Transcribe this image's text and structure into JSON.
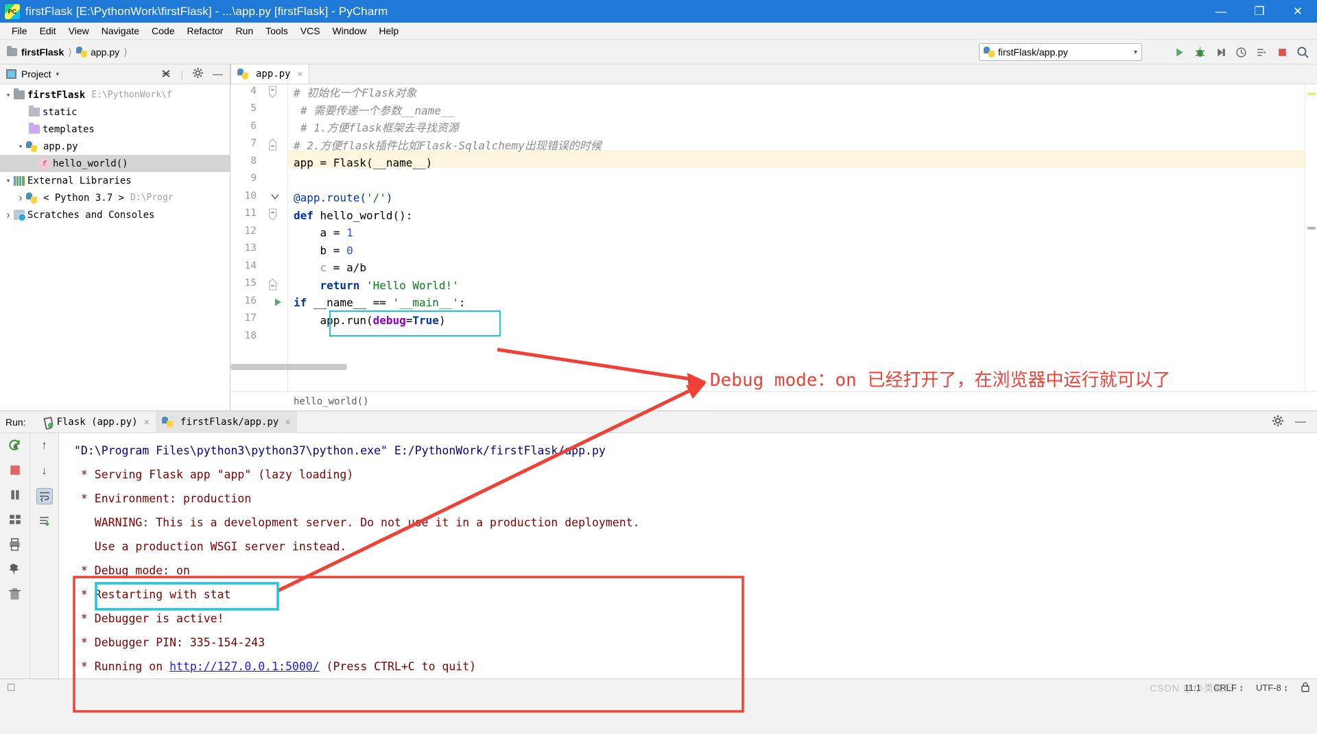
{
  "window": {
    "title": "firstFlask [E:\\PythonWork\\firstFlask] - ...\\app.py [firstFlask] - PyCharm",
    "logo_text": "PC",
    "minimize": "—",
    "maximize": "❐",
    "close": "✕"
  },
  "menubar": [
    "File",
    "Edit",
    "View",
    "Navigate",
    "Code",
    "Refactor",
    "Run",
    "Tools",
    "VCS",
    "Window",
    "Help"
  ],
  "navbar": {
    "breadcrumb": [
      "firstFlask",
      "app.py"
    ],
    "run_config": "firstFlask/app.py",
    "run_config_caret": "▾",
    "icons": [
      "run-icon",
      "debug-icon",
      "coverage-icon",
      "profile-icon",
      "attach-icon",
      "stop-icon",
      "search-icon"
    ]
  },
  "project_panel": {
    "title": "Project",
    "caret": "▾",
    "collapse_all": "collapse-all-icon",
    "settings": "gear-icon",
    "hide": "—",
    "tree": [
      {
        "label": "firstFlask",
        "path": "E:\\PythonWork\\f",
        "depth": 0,
        "arrow": "down",
        "icon": "folder",
        "bold": true,
        "selected": false
      },
      {
        "label": "static",
        "path": "",
        "depth": 1,
        "arrow": "none",
        "icon": "folder-src",
        "bold": false,
        "selected": false
      },
      {
        "label": "templates",
        "path": "",
        "depth": 1,
        "arrow": "none",
        "icon": "folder-tpl",
        "bold": false,
        "selected": false
      },
      {
        "label": "app.py",
        "path": "",
        "depth": 1,
        "arrow": "down",
        "icon": "python",
        "bold": false,
        "selected": false
      },
      {
        "label": "hello_world()",
        "path": "",
        "depth": 2,
        "arrow": "none",
        "icon": "function",
        "bold": false,
        "selected": true
      },
      {
        "label": "External Libraries",
        "path": "",
        "depth": 0,
        "arrow": "down",
        "icon": "library",
        "bold": false,
        "selected": false
      },
      {
        "label": "< Python 3.7 >",
        "path": "D:\\Progr",
        "depth": 1,
        "arrow": "right",
        "icon": "python",
        "bold": false,
        "selected": false
      },
      {
        "label": "Scratches and Consoles",
        "path": "",
        "depth": 0,
        "arrow": "right",
        "icon": "scratches",
        "bold": false,
        "selected": false
      }
    ]
  },
  "editor": {
    "tab": {
      "label": "app.py",
      "close": "✕"
    },
    "breadcrumb": "hello_world()",
    "lines": [
      {
        "num": "4",
        "text": "# 初始化一个Flask对象",
        "type": "comment",
        "fold": "start"
      },
      {
        "num": "5",
        "text": "# 需要传递一个参数__name__",
        "type": "comment",
        "fold": ""
      },
      {
        "num": "6",
        "text": "# 1.方便flask框架去寻找资源",
        "type": "comment",
        "fold": ""
      },
      {
        "num": "7",
        "text": "# 2.方便flask插件比如Flask-Sqlalchemy出现错误的时候",
        "type": "comment",
        "fold": "end"
      },
      {
        "num": "8",
        "text": "app = Flask(__name__)",
        "type": "code",
        "fold": ""
      },
      {
        "num": "9",
        "text": "",
        "type": "code",
        "fold": ""
      },
      {
        "num": "10",
        "text": "@app.route('/')",
        "type": "decorator",
        "fold": "chev"
      },
      {
        "num": "11",
        "text": "def hello_world():",
        "type": "code",
        "fold": "start"
      },
      {
        "num": "12",
        "text": "    a = 1",
        "type": "code",
        "fold": ""
      },
      {
        "num": "13",
        "text": "    b = 0",
        "type": "code",
        "fold": "",
        "highlight": true
      },
      {
        "num": "14",
        "text": "    c = a/b",
        "type": "code",
        "fold": ""
      },
      {
        "num": "15",
        "text": "    return 'Hello World!'",
        "type": "code",
        "fold": "end"
      },
      {
        "num": "16",
        "text": "if __name__ == '__main__':",
        "type": "code",
        "fold": "run"
      },
      {
        "num": "17",
        "text": "    app.run(debug=True)",
        "type": "code",
        "fold": ""
      },
      {
        "num": "18",
        "text": "",
        "type": "code",
        "fold": ""
      }
    ]
  },
  "run_panel": {
    "label": "Run:",
    "tabs": [
      {
        "label": "Flask (app.py)",
        "icon": "flask-icon",
        "active": false,
        "close": "✕"
      },
      {
        "label": "firstFlask/app.py",
        "icon": "python-icon",
        "active": true,
        "close": "✕"
      }
    ],
    "header_icons": [
      "gear-icon",
      "hide-icon"
    ],
    "tools_left": [
      "rerun-icon",
      "stop-icon",
      "pause-icon",
      "layout-icon",
      "print-icon",
      "pin-icon",
      "trash-icon"
    ],
    "tools_right": [
      "up-arrow-icon",
      "down-arrow-icon",
      "soft-wrap-icon",
      "scroll-to-end-icon"
    ],
    "console": [
      {
        "text": "\"D:\\Program Files\\python3\\python37\\python.exe\" E:/PythonWork/firstFlask/app.py",
        "style": "command"
      },
      {
        "text": " * Serving Flask app \"app\" (lazy loading)",
        "style": "normal"
      },
      {
        "text": " * Environment: production",
        "style": "normal"
      },
      {
        "text": "   WARNING: This is a development server. Do not use it in a production deployment.",
        "style": "normal"
      },
      {
        "text": "   Use a production WSGI server instead.",
        "style": "normal"
      },
      {
        "text": " * Debug mode: on",
        "style": "normal",
        "boxed": true
      },
      {
        "text": " * Restarting with stat",
        "style": "normal"
      },
      {
        "text": " * Debugger is active!",
        "style": "normal"
      },
      {
        "text": " * Debugger PIN: 335-154-243",
        "style": "normal"
      },
      {
        "text": " * Running on ",
        "style": "normal",
        "link": "http://127.0.0.1:5000/",
        "suffix": " (Press CTRL+C to quit)"
      }
    ]
  },
  "annotation": {
    "text": "Debug mode：on 已经打开了，在浏览器中运行就可以了",
    "color": "#ef4136",
    "highlight_color": "#18c8d8"
  },
  "statusbar": {
    "position": "11:1",
    "line_sep": "CRLF",
    "line_sep_caret": "↕",
    "encoding": "UTF-8",
    "encoding_caret": "↕",
    "lock": "🔒",
    "watermark": "CSDN @小类能扫"
  }
}
